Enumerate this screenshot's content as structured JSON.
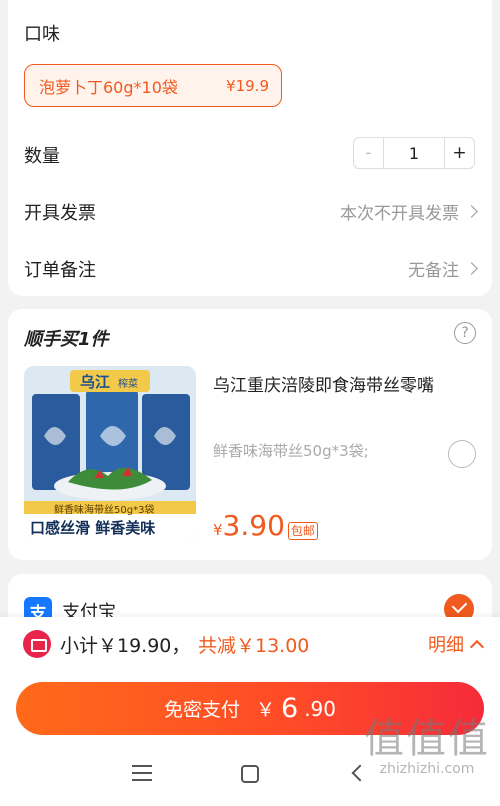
{
  "flavor": {
    "label": "口味",
    "option_name": "泡萝卜丁60g*10袋",
    "option_price": "¥19.9"
  },
  "quantity": {
    "label": "数量",
    "minus": "-",
    "value": "1",
    "plus": "+"
  },
  "invoice": {
    "label": "开具发票",
    "value": "本次不开具发票"
  },
  "remark": {
    "label": "订单备注",
    "value": "无备注"
  },
  "addon": {
    "title": "顺手买1件",
    "help": "?",
    "product": {
      "title": "乌江重庆涪陵即食海带丝零嘴",
      "spec": "鲜香味海带丝50g*3袋;",
      "price_currency": "¥",
      "price": "3.90",
      "tag": "包邮",
      "image_brand": "乌江",
      "image_sub": "榨菜",
      "image_pack_label": "鲜香味海带丝50g*3袋",
      "image_slogan": "口感丝滑 鲜香美味"
    }
  },
  "payment": {
    "method": "支付宝",
    "icon_char": "支"
  },
  "summary": {
    "subtotal": "小计￥19.90，",
    "discount": "共减￥13.00",
    "detail": "明细"
  },
  "pay_button": {
    "label": "免密支付",
    "currency": "￥",
    "amount_int": "6",
    "amount_dec": ".90"
  },
  "watermark": {
    "big": "值值值",
    "small": "zhizhizhi.com"
  },
  "colors": {
    "accent": "#f05a1e",
    "alipay": "#1677ff",
    "coupon": "#e8244a"
  }
}
